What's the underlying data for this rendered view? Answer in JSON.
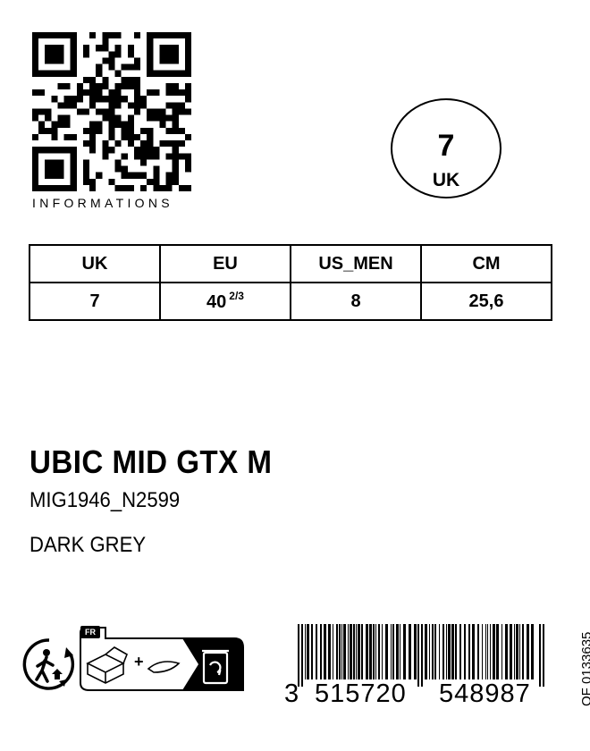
{
  "qr": {
    "caption": "INFORMATIONS"
  },
  "size_badge": {
    "value": "7",
    "unit": "UK"
  },
  "size_table": {
    "headers": [
      "UK",
      "EU",
      "US_MEN",
      "CM"
    ],
    "values": {
      "uk": "7",
      "eu_whole": "40",
      "eu_fraction": "2/3",
      "us_men": "8",
      "cm": "25,6"
    }
  },
  "product": {
    "name": "UBIC MID GTX M",
    "code": "MIG1946_N2599",
    "color": "DARK GREY"
  },
  "recycling": {
    "country_badge": "FR",
    "plus_sign": "+",
    "icons": [
      "triman-icon",
      "box-icon",
      "paper-icon",
      "recycling-bin-icon"
    ]
  },
  "barcode": {
    "first_digit": "3",
    "left_group": "515720",
    "right_group": "548987"
  },
  "side_code": "OF 0133635"
}
